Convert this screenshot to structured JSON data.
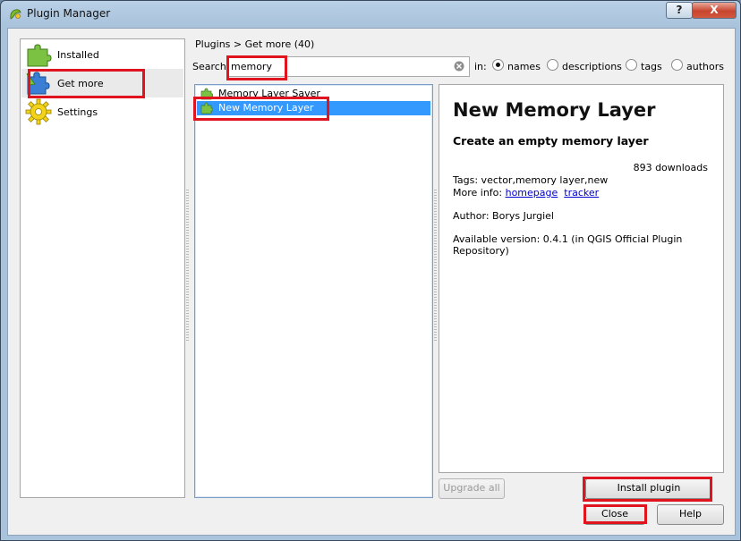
{
  "window": {
    "title": "Plugin Manager",
    "help_button": "?",
    "close_button": "X"
  },
  "sidebar": {
    "items": [
      {
        "label": "Installed",
        "icon": "puzzle-green-icon"
      },
      {
        "label": "Get more",
        "icon": "puzzle-blue-icon"
      },
      {
        "label": "Settings",
        "icon": "gear-yellow-icon"
      }
    ],
    "selected": "Get more"
  },
  "breadcrumb": "Plugins > Get more (40)",
  "search": {
    "label": "Search",
    "value": "memory",
    "in_label": "in:",
    "options": [
      "names",
      "descriptions",
      "tags",
      "authors"
    ],
    "selected": "names"
  },
  "plugins": [
    {
      "name": "Memory Layer Saver",
      "selected": false
    },
    {
      "name": "New Memory Layer",
      "selected": true
    }
  ],
  "details": {
    "name": "New Memory Layer",
    "description": "Create an empty memory layer",
    "downloads": "893 downloads",
    "tags": "Tags: vector,memory layer,new",
    "more_info_label": "More info:",
    "homepage_link": "homepage",
    "tracker_link": "tracker",
    "author": "Author: Borys Jurgiel",
    "version": "Available version: 0.4.1 (in QGIS Official Plugin Repository)"
  },
  "buttons": {
    "upgrade_all": "Upgrade all",
    "install": "Install plugin",
    "close": "Close",
    "help": "Help"
  },
  "colors": {
    "highlight": "#e0141e",
    "selection": "#3399ff",
    "link": "#0000cc"
  }
}
